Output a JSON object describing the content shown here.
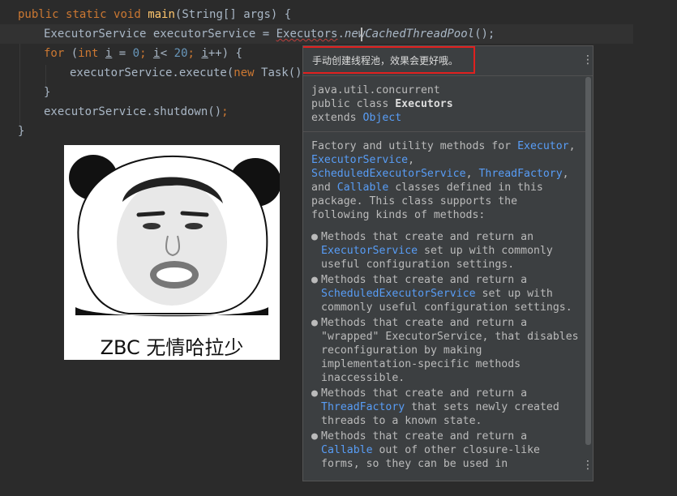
{
  "code": {
    "line1": {
      "kw1": "public",
      "kw2": "static",
      "kw3": "void",
      "method": "main",
      "rest": "(String[] args) {"
    },
    "line2": {
      "type": "ExecutorService",
      "var": "executorService",
      "eq": " = ",
      "cls": "Executors",
      "dot": ".",
      "call": "newCachedThreadPool",
      "tail": "();"
    },
    "line3": {
      "kw_for": "for",
      "open": " (",
      "kw_int": "int",
      "sp": " ",
      "i1": "i",
      "eq": " = ",
      "zero": "0",
      "semi1": ";",
      "lt": " < ",
      "twenty": "20",
      "semi2": ";",
      "inc": "++) {"
    },
    "line4": {
      "text": "executorService.execute(",
      "kw_new": "new",
      "rest": " Task())"
    },
    "line5": {
      "text": "}"
    },
    "line6": {
      "text": "executorService.shutdown()",
      "semi": ";"
    },
    "line7": {
      "text": "}"
    }
  },
  "meme": {
    "caption": "ZBC 无情哈拉少"
  },
  "popup": {
    "hint": "手动创建线程池，效果会更好哦。",
    "menu_icon": "more-vertical-icon",
    "header": {
      "package": "java.util.concurrent",
      "decl_prefix": "public class ",
      "class_name": "Executors",
      "extends_kw": "extends ",
      "extends_name": "Object"
    },
    "intro": {
      "t1": "Factory and utility methods for ",
      "l1": "Executor",
      "t2": ", ",
      "l2": "ExecutorService",
      "t3": ", ",
      "l3": "ScheduledExecutorService",
      "t4": ", ",
      "l4": "ThreadFactory",
      "t5": ", and ",
      "l5": "Callable",
      "t6": " classes defined in this package. This class supports the following kinds of methods:"
    },
    "bullets": [
      {
        "pre": "Methods that create and return an ",
        "link": "ExecutorService",
        "post": " set up with commonly useful configuration settings."
      },
      {
        "pre": "Methods that create and return a ",
        "link": "ScheduledExecutorService",
        "post": " set up with commonly useful configuration settings."
      },
      {
        "pre": "Methods that create and return a \"wrapped\" ExecutorService, that disables reconfiguration by making implementation-specific methods inaccessible.",
        "link": "",
        "post": ""
      },
      {
        "pre": "Methods that create and return a ",
        "link": "ThreadFactory",
        "post": " that sets newly created threads to a known state."
      },
      {
        "pre": "Methods that create and return a ",
        "link": "Callable",
        "post": " out of other closure-like forms, so they can be used in"
      }
    ],
    "bullet_char": "●"
  }
}
